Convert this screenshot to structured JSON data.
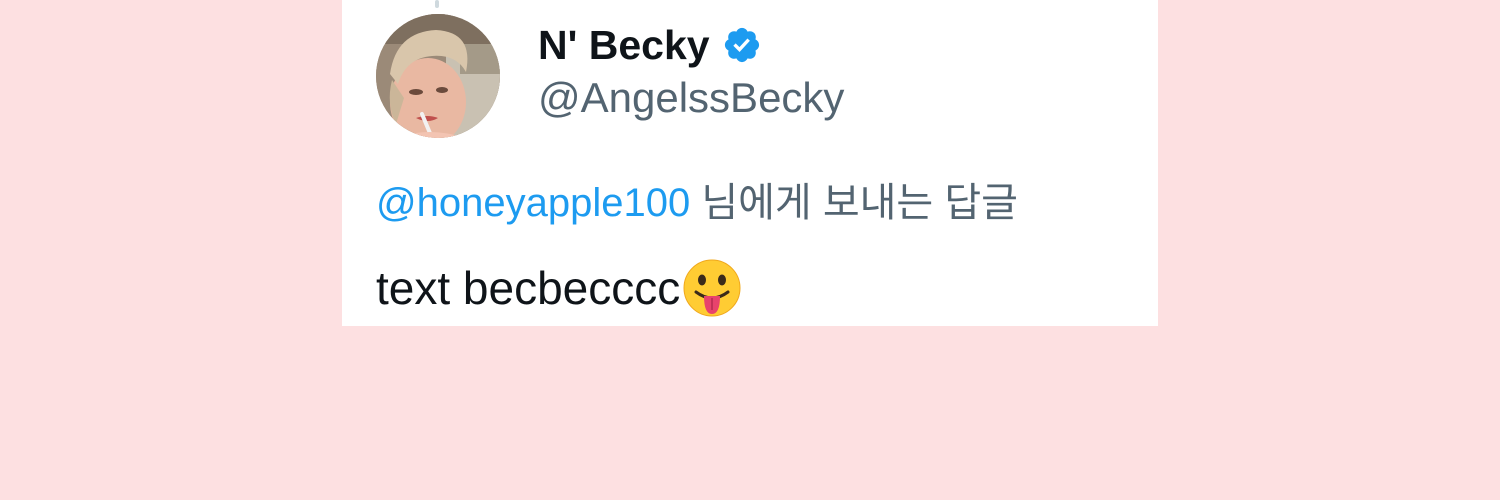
{
  "tweet": {
    "display_name": "N' Becky",
    "handle": "@AngelssBecky",
    "verified": true,
    "reply_mention": "@honeyapple100",
    "reply_suffix": " 님에게 보내는 답글",
    "text": "text becbecccc",
    "emoji": "face-with-tongue",
    "colors": {
      "background": "#fde0e1",
      "card": "#ffffff",
      "name": "#0f1419",
      "secondary": "#536471",
      "link": "#1d9bf0",
      "verified": "#1d9bf0"
    }
  }
}
